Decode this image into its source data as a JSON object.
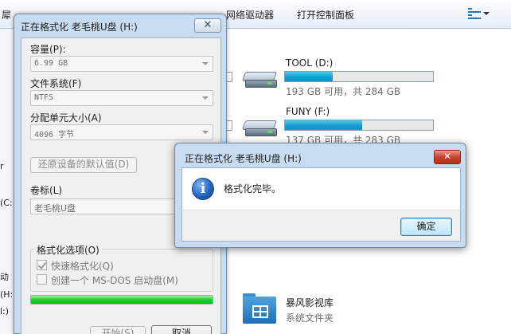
{
  "toolbar": {
    "truncated_item": "犀",
    "map_network_drive": "网络驱动器",
    "open_control_panel": "打开控制面板",
    "view_icon": "view-options-icon"
  },
  "left_pane_fragments": [
    "r",
    "(C:",
    "动",
    "(H:",
    "l:)"
  ],
  "drives": [
    {
      "name": "TOOL (D:)",
      "info": "193 GB 可用，共 284 GB",
      "used_fraction": 0.32
    },
    {
      "name": "FUNY (F:)",
      "info": "137 GB 可用，共 283 GB",
      "used_fraction": 0.52
    }
  ],
  "folder": {
    "name": "暴风影视库",
    "type": "系统文件夹"
  },
  "format_dialog": {
    "title": "正在格式化 老毛桃U盘 (H:)",
    "close_label": "✕",
    "capacity_label": "容量(P):",
    "capacity_value": "6.99 GB",
    "filesystem_label": "文件系统(F)",
    "filesystem_value": "NTFS",
    "alloc_label": "分配单元大小(A)",
    "alloc_value": "4096 字节",
    "restore_defaults": "还原设备的默认值(D)",
    "volume_label": "卷标(L)",
    "volume_value": "老毛桃U盘",
    "options_legend": "格式化选项(O)",
    "quick_format": "快速格式化(Q)",
    "quick_format_checked": true,
    "msdos_startup": "创建一个 MS-DOS 启动盘(M)",
    "msdos_checked": false,
    "progress_fraction": 1.0,
    "start_button": "开始(S)",
    "cancel_button": "取消"
  },
  "message_box": {
    "title": "正在格式化 老毛桃U盘 (H:)",
    "close_label": "✕",
    "icon": "info-icon",
    "icon_glyph": "i",
    "text": "格式化完毕。",
    "ok_button": "确定"
  }
}
